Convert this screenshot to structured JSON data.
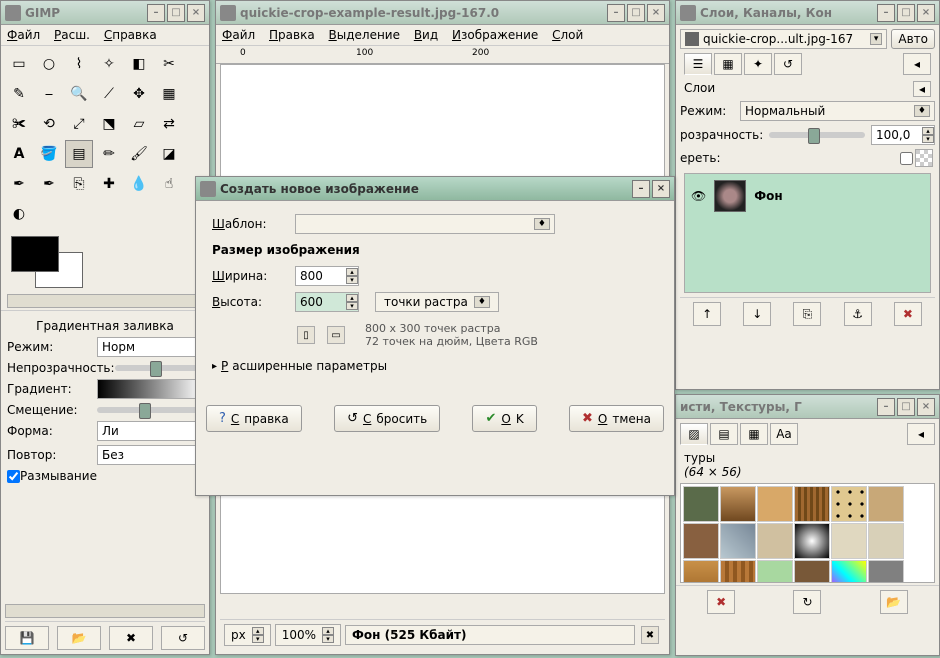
{
  "toolbox": {
    "title": "GIMP",
    "menu": [
      "Файл",
      "Расш.",
      "Справка"
    ],
    "option_title": "Градиентная заливка",
    "mode_label": "Режим:",
    "mode_value": "Норм",
    "opacity_label": "Непрозрачность:",
    "gradient_label": "Градиент:",
    "offset_label": "Смещение:",
    "shape_label": "Форма:",
    "shape_value": "Ли",
    "repeat_label": "Повтор:",
    "repeat_value": "Без",
    "dither_label": "Размывание"
  },
  "canvas": {
    "title": "quickie-crop-example-result.jpg-167.0",
    "menu": [
      "Файл",
      "Правка",
      "Выделение",
      "Вид",
      "Изображение",
      "Слой"
    ],
    "ruler_ticks": [
      "0",
      "100",
      "200"
    ],
    "unit": "px",
    "zoom": "100%",
    "status": "Фон (525 Кбайт)"
  },
  "layers": {
    "title": "Слои, Каналы, Кон",
    "file_combo": "quickie-crop...ult.jpg-167",
    "auto": "Авто",
    "panel_label": "Слои",
    "mode_label": "Режим:",
    "mode_value": "Нормальный",
    "opacity_label": "розрачность:",
    "opacity_value": "100,0",
    "lock_label": "ереть:",
    "layer_name": "Фон"
  },
  "brushes": {
    "title": "исти, Текстуры, Г",
    "panel": "туры",
    "size": "(64 × 56)"
  },
  "dialog": {
    "title": "Создать новое изображение",
    "template_label": "Шаблон:",
    "size_title": "Размер изображения",
    "width_label": "Ширина:",
    "width_value": "800",
    "height_label": "Высота:",
    "height_value": "600",
    "units": "точки растра",
    "info1": "800 x 300 точек растра",
    "info2": "72 точек на дюйм, Цвета RGB",
    "advanced": "Расширенные параметры",
    "help": "Справка",
    "reset": "Сбросить",
    "ok": "OK",
    "cancel": "Отмена"
  }
}
